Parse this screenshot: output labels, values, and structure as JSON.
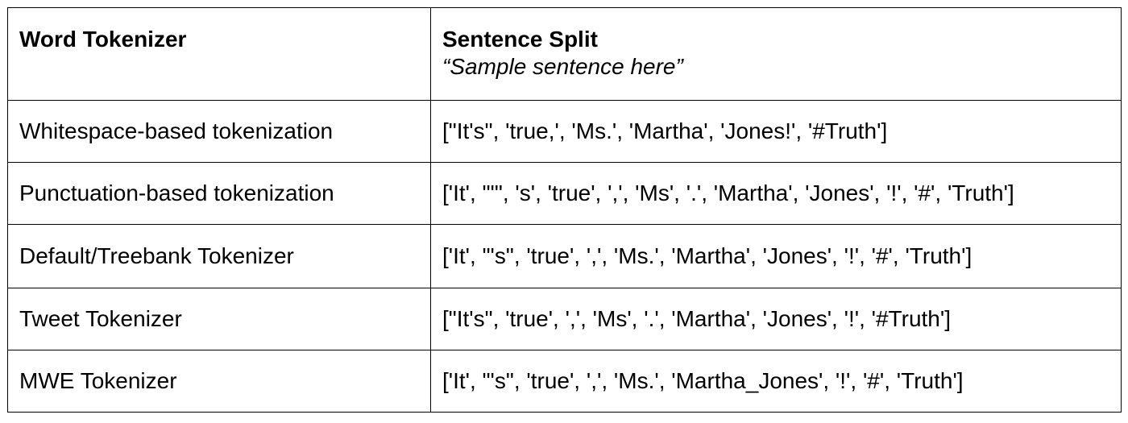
{
  "header": {
    "col1_title": "Word Tokenizer",
    "col2_title": "Sentence Split",
    "col2_subtitle": "“Sample sentence here”"
  },
  "rows": [
    {
      "name": "Whitespace-based tokenization",
      "split": "[\"It's\", 'true,', 'Ms.', 'Martha', 'Jones!', '#Truth']"
    },
    {
      "name": "Punctuation-based tokenization",
      "split": "['It', \"'\", 's', 'true', ',', 'Ms', '.', 'Martha', 'Jones', '!', '#', 'Truth']"
    },
    {
      "name": "Default/Treebank Tokenizer",
      "split": "['It', \"'s\", 'true', ',', 'Ms.', 'Martha', 'Jones', '!', '#', 'Truth']"
    },
    {
      "name": "Tweet Tokenizer",
      "split": " [\"It's\", 'true', ',', 'Ms', '.', 'Martha', 'Jones', '!', '#Truth']"
    },
    {
      "name": "MWE Tokenizer",
      "split": "['It', \"'s\", 'true', ',', 'Ms.', 'Martha_Jones', '!', '#', 'Truth']"
    }
  ]
}
